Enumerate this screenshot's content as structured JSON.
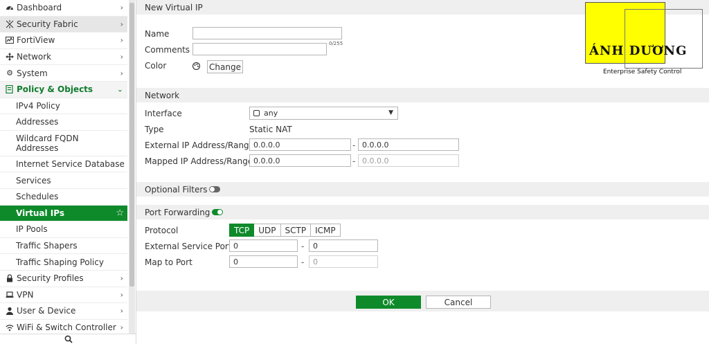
{
  "sidebar": {
    "items": [
      {
        "label": "Dashboard",
        "icon": "dashboard-icon"
      },
      {
        "label": "Security Fabric",
        "icon": "security-fabric-icon"
      },
      {
        "label": "FortiView",
        "icon": "fortiview-icon"
      },
      {
        "label": "Network",
        "icon": "network-icon"
      },
      {
        "label": "System",
        "icon": "gear-icon"
      },
      {
        "label": "Policy & Objects",
        "icon": "policy-objects-icon"
      },
      {
        "label": "Security Profiles",
        "icon": "lock-icon"
      },
      {
        "label": "VPN",
        "icon": "vpn-laptop-icon"
      },
      {
        "label": "User & Device",
        "icon": "user-icon"
      },
      {
        "label": "WiFi & Switch Controller",
        "icon": "wifi-icon"
      }
    ],
    "subitems": [
      "IPv4 Policy",
      "Addresses",
      "Wildcard FQDN Addresses",
      "Internet Service Database",
      "Services",
      "Schedules",
      "Virtual IPs",
      "IP Pools",
      "Traffic Shapers",
      "Traffic Shaping Policy"
    ]
  },
  "form": {
    "title": "New Virtual IP",
    "name_label": "Name",
    "name_value": "",
    "comments_label": "Comments",
    "comments_value": "",
    "comments_counter": "0/255",
    "color_label": "Color",
    "color_change_button": "Change",
    "network_header": "Network",
    "interface_label": "Interface",
    "interface_value": "any",
    "type_label": "Type",
    "type_value": "Static NAT",
    "ext_ip_label": "External IP Address/Range",
    "ext_ip_start": "0.0.0.0",
    "ext_ip_end": "0.0.0.0",
    "mapped_ip_label": "Mapped IP Address/Range",
    "mapped_ip_start": "0.0.0.0",
    "mapped_ip_end": "0.0.0.0",
    "range_separator": "-",
    "optional_filters_label": "Optional Filters",
    "optional_filters_enabled": false,
    "port_forwarding_label": "Port Forwarding",
    "port_forwarding_enabled": true,
    "protocol_label": "Protocol",
    "protocols": [
      "TCP",
      "UDP",
      "SCTP",
      "ICMP"
    ],
    "protocol_selected": "TCP",
    "ext_port_label": "External Service Port",
    "ext_port_start": "0",
    "ext_port_end": "0",
    "map_port_label": "Map to Port",
    "map_port_start": "0",
    "map_port_end": "0",
    "ok_button": "OK",
    "cancel_button": "Cancel"
  },
  "logo": {
    "brand": "ÁNH DƯƠNG",
    "tagline": "Enterprise Safety Control"
  },
  "colors": {
    "accent": "#0e8a2b",
    "group_open_text": "#107c2d",
    "logo_yellow": "#ffff00"
  }
}
